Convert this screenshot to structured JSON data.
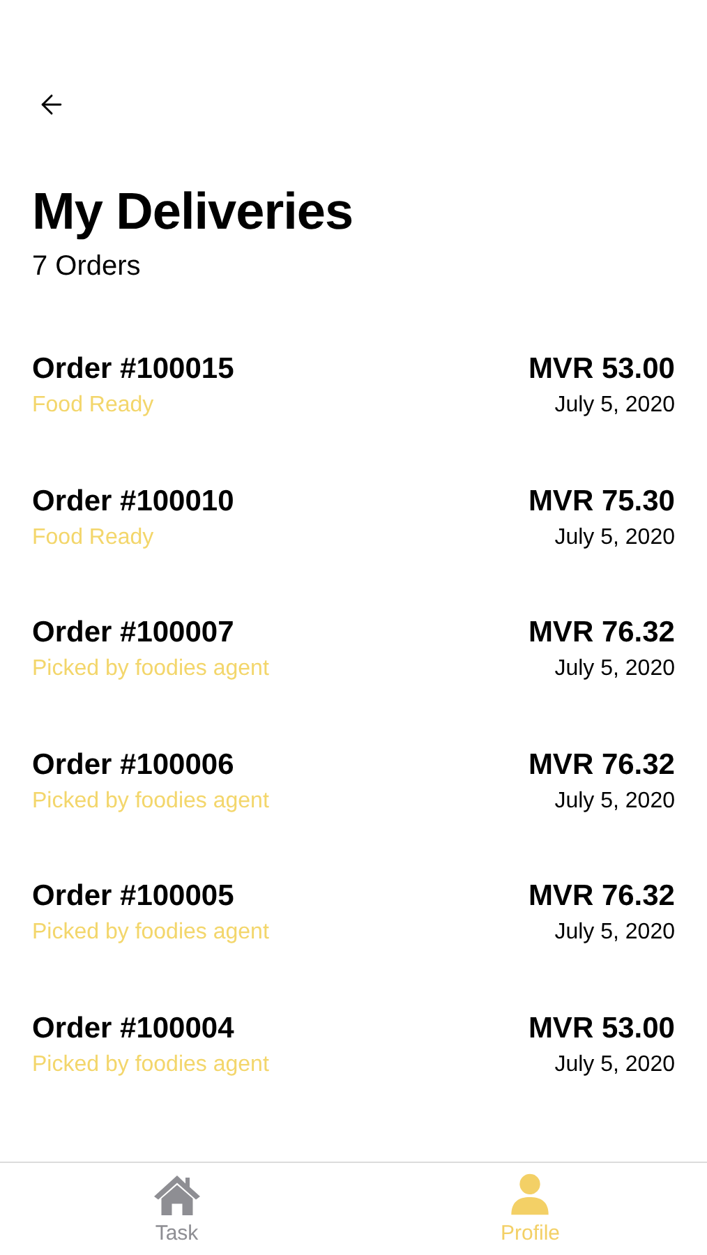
{
  "header": {
    "title": "My Deliveries",
    "subtitle": "7 Orders"
  },
  "orders": [
    {
      "order": "Order #100015",
      "status": "Food Ready",
      "amount": "MVR 53.00",
      "date": "July 5, 2020"
    },
    {
      "order": "Order #100010",
      "status": "Food Ready",
      "amount": "MVR 75.30",
      "date": "July 5, 2020"
    },
    {
      "order": "Order #100007",
      "status": "Picked by foodies agent",
      "amount": "MVR 76.32",
      "date": "July 5, 2020"
    },
    {
      "order": "Order #100006",
      "status": "Picked by foodies agent",
      "amount": "MVR 76.32",
      "date": "July 5, 2020"
    },
    {
      "order": "Order #100005",
      "status": "Picked by foodies agent",
      "amount": "MVR 76.32",
      "date": "July 5, 2020"
    },
    {
      "order": "Order #100004",
      "status": "Picked by foodies agent",
      "amount": "MVR 53.00",
      "date": "July 5, 2020"
    }
  ],
  "tabs": [
    {
      "kind": "home",
      "label": "Task",
      "selected": false
    },
    {
      "kind": "person",
      "label": "Profile",
      "selected": true
    }
  ]
}
